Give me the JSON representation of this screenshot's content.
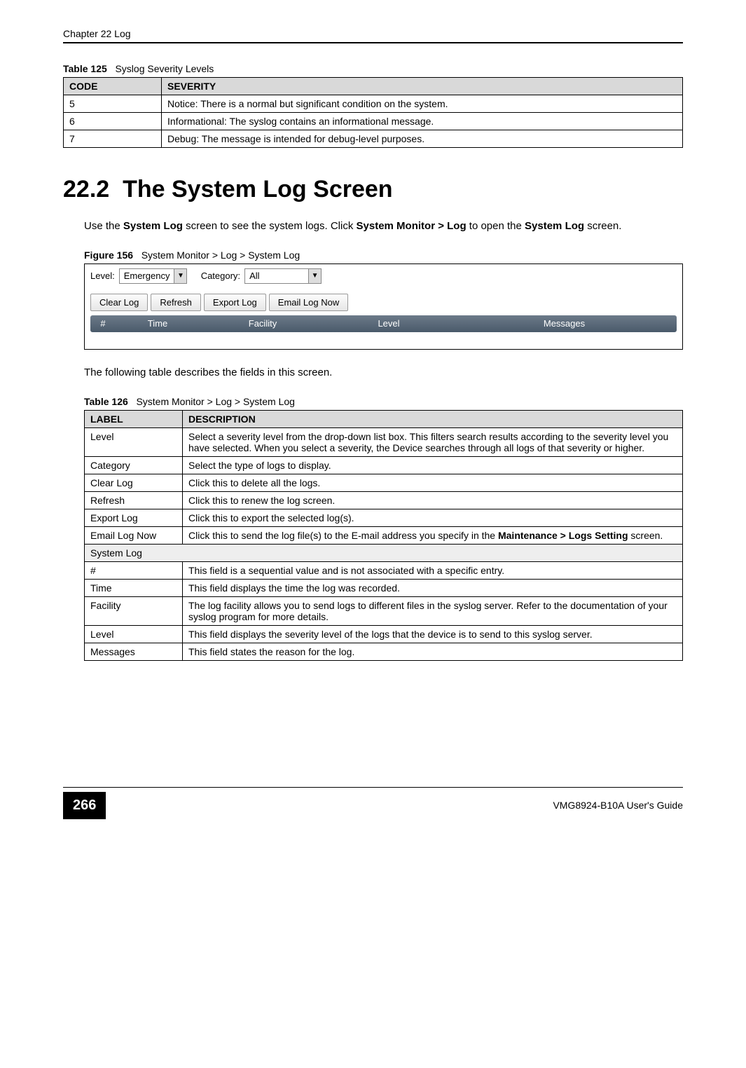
{
  "header": {
    "chapter": "Chapter 22 Log"
  },
  "table125": {
    "caption_label": "Table 125",
    "caption_text": "Syslog Severity Levels",
    "headers": {
      "code": "CODE",
      "severity": "SEVERITY"
    },
    "rows": [
      {
        "code": "5",
        "severity": "Notice: There is a normal but significant condition on the system."
      },
      {
        "code": "6",
        "severity": "Informational: The syslog contains an informational message."
      },
      {
        "code": "7",
        "severity": "Debug: The message is intended for debug-level purposes."
      }
    ]
  },
  "section": {
    "number": "22.2",
    "title": "The System Log Screen"
  },
  "intro": {
    "pre": "Use the ",
    "b1": "System Log",
    "mid1": " screen to see the system logs. Click ",
    "b2": "System Monitor > Log",
    "mid2": " to open the ",
    "b3": "System Log",
    "post": " screen."
  },
  "figure156": {
    "caption_label": "Figure 156",
    "caption_text": "System Monitor > Log > System Log",
    "level_label": "Level:",
    "level_value": "Emergency",
    "category_label": "Category:",
    "category_value": "All",
    "buttons": {
      "clear": "Clear Log",
      "refresh": "Refresh",
      "export": "Export Log",
      "email": "Email Log Now"
    },
    "columns": {
      "num": "#",
      "time": "Time",
      "facility": "Facility",
      "level": "Level",
      "messages": "Messages"
    }
  },
  "para2": "The following table describes the fields in this screen.",
  "table126": {
    "caption_label": "Table 126",
    "caption_text": "System Monitor > Log > System Log",
    "headers": {
      "label": "LABEL",
      "description": "DESCRIPTION"
    },
    "rows": [
      {
        "label": "Level",
        "description": "Select a severity level from the drop-down list box. This filters search results according to the severity level you have selected. When you select a severity, the Device searches through all logs of that severity or higher."
      },
      {
        "label": "Category",
        "description": "Select the type of logs to display."
      },
      {
        "label": "Clear Log",
        "description": "Click this to delete all the logs."
      },
      {
        "label": "Refresh",
        "description": "Click this to renew the log screen."
      },
      {
        "label": "Export Log",
        "description": "Click this to export the selected log(s)."
      }
    ],
    "email_row": {
      "label": "Email Log Now",
      "pre": "Click this to send the log file(s) to the E-mail address you specify in the ",
      "bold": "Maintenance > Logs Setting",
      "post": " screen."
    },
    "section_row": "System Log",
    "rows2": [
      {
        "label": "#",
        "description": "This field is a sequential value and is not associated with a specific entry."
      },
      {
        "label": "Time",
        "description": "This field displays the time the log was recorded."
      },
      {
        "label": "Facility",
        "description": "The log facility allows you to send logs to different files in the syslog server. Refer to the documentation of your syslog program for more details."
      },
      {
        "label": "Level",
        "description": "This field displays the severity level of the logs that the device is to send to this syslog server."
      },
      {
        "label": "Messages",
        "description": "This field states the reason for the log."
      }
    ]
  },
  "footer": {
    "page_number": "266",
    "guide": "VMG8924-B10A User's Guide"
  }
}
